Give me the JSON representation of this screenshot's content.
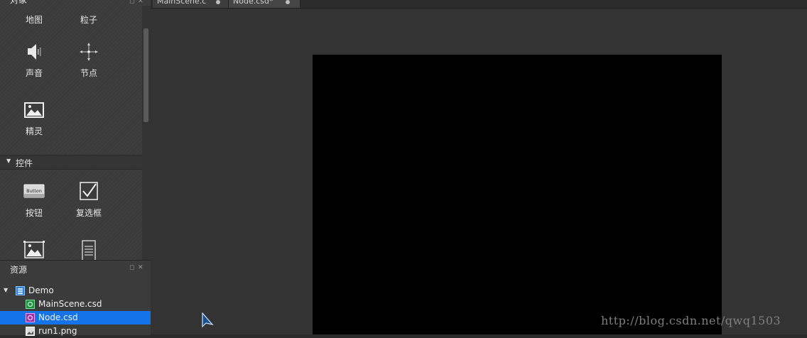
{
  "objects_panel": {
    "title": "对象",
    "tools": [
      {
        "label": "地图",
        "icon": "map-icon"
      },
      {
        "label": "粒子",
        "icon": "particle-icon"
      },
      {
        "label": "声音",
        "icon": "speaker-icon"
      },
      {
        "label": "节点",
        "icon": "node-icon"
      },
      {
        "label": "精灵",
        "icon": "image-icon"
      }
    ]
  },
  "controls_section": {
    "title": "控件",
    "tools": [
      {
        "label": "按钮",
        "icon": "button-icon",
        "icon_text": "Button"
      },
      {
        "label": "复选框",
        "icon": "checkbox-icon"
      },
      {
        "label": "",
        "icon": "image-view-icon"
      },
      {
        "label": "",
        "icon": "text-icon"
      }
    ]
  },
  "assets_panel": {
    "title": "资源",
    "tree": [
      {
        "label": "Demo",
        "icon": "project-icon",
        "level": 0,
        "expanded": true,
        "selected": false
      },
      {
        "label": "MainScene.csd",
        "icon": "csd-scene-icon",
        "level": 1,
        "selected": false
      },
      {
        "label": "Node.csd",
        "icon": "csd-node-icon",
        "level": 1,
        "selected": true
      },
      {
        "label": "run1.png",
        "icon": "png-icon",
        "level": 1,
        "selected": false
      }
    ]
  },
  "tabs": [
    {
      "label": "MainScene.c",
      "active": false
    },
    {
      "label": "Node.csd*",
      "active": true
    }
  ],
  "watermark": "http://blog.csdn.net/qwq1503",
  "colors": {
    "selection": "#1473e6",
    "panel": "#3b3b3b",
    "editor_bg": "#333333",
    "scene": "#000000"
  }
}
